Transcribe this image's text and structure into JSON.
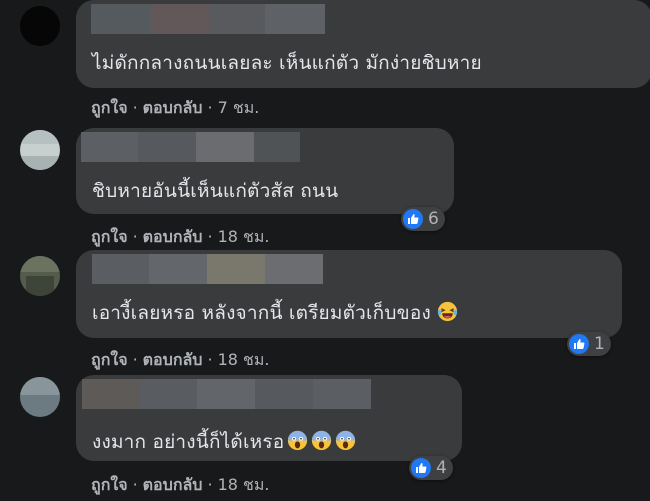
{
  "comments": [
    {
      "text": "ไม่ดักกลางถนนเลยละ เห็นแก่ตัว มักง่ายชิบหาย",
      "like": "ถูกใจ",
      "reply": "ตอบกลับ",
      "time": "7 ชม.",
      "reactions": ""
    },
    {
      "text": "ชิบหายอันนี้เห็นแก่ตัวสัส ถนน",
      "like": "ถูกใจ",
      "reply": "ตอบกลับ",
      "time": "18 ชม.",
      "reactions": "6",
      "reaction_icon": "like-icon"
    },
    {
      "text": "เอางี้เลยหรอ หลังจากนี้ เตรียมตัวเก็บของ",
      "emoji": "laughing-crying-emoji",
      "like": "ถูกใจ",
      "reply": "ตอบกลับ",
      "time": "18 ชม.",
      "reactions": "1",
      "reaction_icon": "like-icon"
    },
    {
      "text": "งงมาก อย่างนี้ก็ได้เหรอ",
      "emoji": "screaming-face-emoji",
      "emoji_count": 3,
      "like": "ถูกใจ",
      "reply": "ตอบกลับ",
      "time": "18 ชม.",
      "reactions": "4",
      "reaction_icon": "like-icon"
    }
  ],
  "separator": "·",
  "colors": {
    "background": "#18191a",
    "bubble": "#3a3b3c",
    "text": "#e4e6eb",
    "muted": "#b0b3b8",
    "like_blue": "#2078f4"
  }
}
